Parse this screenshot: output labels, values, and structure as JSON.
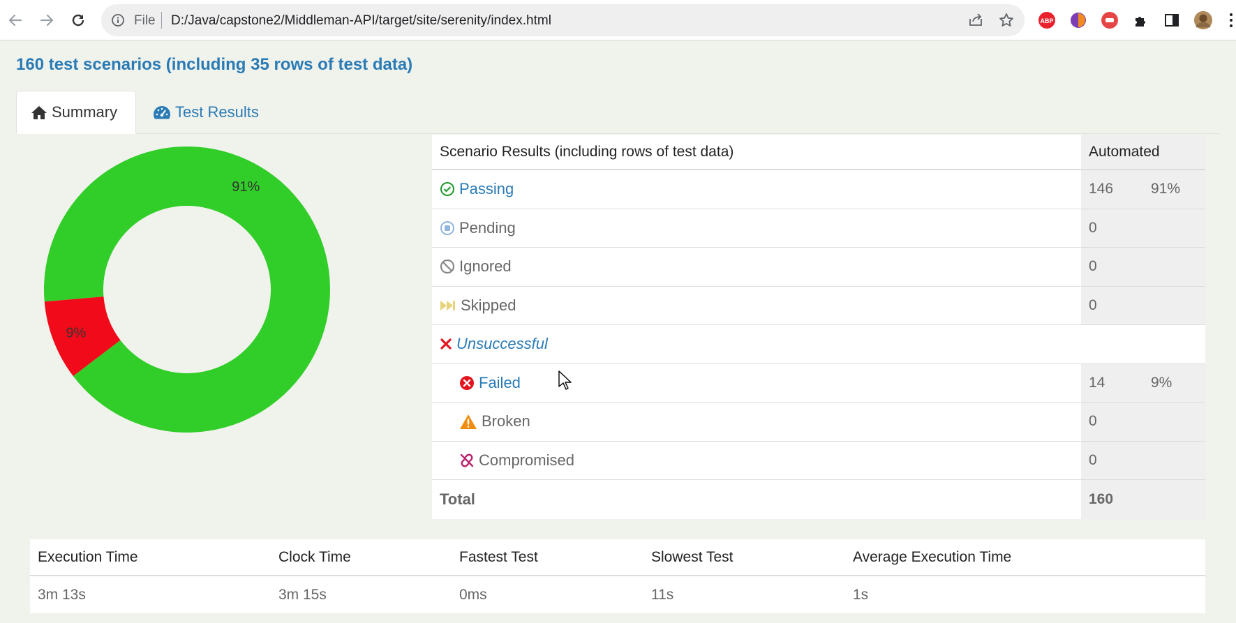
{
  "browser": {
    "omnibox_scheme": "File",
    "url": "D:/Java/capstone2/Middleman-API/target/site/serenity/index.html",
    "icons": [
      "back-arrow-icon",
      "forward-arrow-icon",
      "reload-icon",
      "info-icon",
      "share-icon",
      "star-icon",
      "adblock-extension-icon",
      "extension-icon",
      "extension-icon",
      "puzzle-icon",
      "side-panel-icon",
      "profile-avatar"
    ]
  },
  "page": {
    "title": "160 test scenarios (including 35 rows of test data)",
    "tabs": [
      {
        "label": "Summary",
        "icon": "home-icon",
        "active": true
      },
      {
        "label": "Test Results",
        "icon": "dashboard-icon",
        "active": false
      }
    ]
  },
  "chart_data": {
    "type": "pie",
    "donut": true,
    "categories": [
      "Passing",
      "Failed"
    ],
    "values": [
      91,
      9
    ],
    "labels": [
      "91%",
      "9%"
    ],
    "colors": [
      "#31cd28",
      "#f10b1a"
    ]
  },
  "results": {
    "header": {
      "label": "Scenario Results (including rows of test data)",
      "automated": "Automated"
    },
    "rows": [
      {
        "label": "Passing",
        "count": "146",
        "percent": "91%",
        "icon": "check-circle-icon"
      },
      {
        "label": "Pending",
        "count": "0",
        "percent": "",
        "icon": "pending-circle-icon"
      },
      {
        "label": "Ignored",
        "count": "0",
        "percent": "",
        "icon": "ban-icon"
      },
      {
        "label": "Skipped",
        "count": "0",
        "percent": "",
        "icon": "fast-forward-icon"
      },
      {
        "label": "Unsuccessful",
        "count": "",
        "percent": "",
        "icon": "x-icon"
      },
      {
        "label": "Failed",
        "count": "14",
        "percent": "9%",
        "icon": "x-circle-icon"
      },
      {
        "label": "Broken",
        "count": "0",
        "percent": "",
        "icon": "warning-icon"
      },
      {
        "label": "Compromised",
        "count": "0",
        "percent": "",
        "icon": "broken-link-icon"
      }
    ],
    "total": {
      "label": "Total",
      "count": "160"
    }
  },
  "timing": {
    "headers": [
      "Execution Time",
      "Clock Time",
      "Fastest Test",
      "Slowest Test",
      "Average Execution Time"
    ],
    "values": [
      "3m 13s",
      "3m 15s",
      "0ms",
      "11s",
      "1s"
    ]
  }
}
